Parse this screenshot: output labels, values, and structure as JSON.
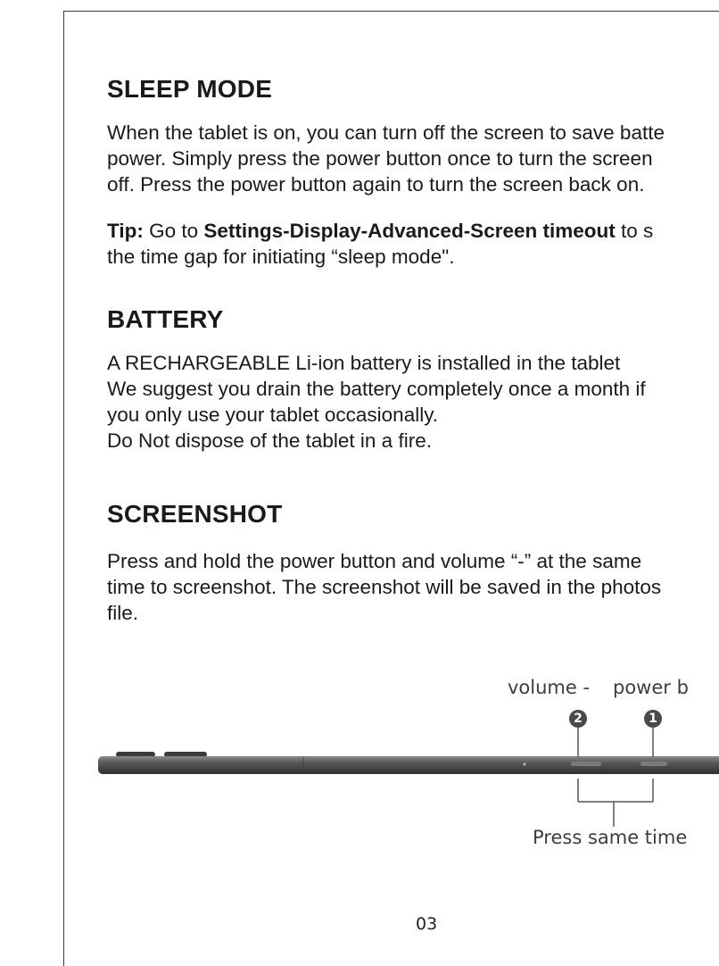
{
  "sleep": {
    "heading": "SLEEP MODE",
    "p1": [
      "When the tablet is on, you can turn off the screen to save batte",
      "power. Simply press the power button once to turn the screen",
      "off. Press the power button again to turn the screen back on."
    ],
    "tip_label": "Tip:",
    "tip_text_1": " Go to ",
    "tip_path": "Settings-Display-Advanced-Screen timeout",
    "tip_text_2": " to s",
    "tip_line2": "the time gap for initiating “sleep mode\"."
  },
  "battery": {
    "heading": "BATTERY",
    "lines": [
      "A RECHARGEABLE Li-ion battery is installed in the tablet",
      "We suggest you drain the battery completely once a month if",
      "you only use your tablet occasionally.",
      "Do Not dispose of the tablet in a fire."
    ]
  },
  "screenshot": {
    "heading": "SCREENSHOT",
    "lines": [
      "Press and hold the power button and volume “-” at the same",
      "time to screenshot. The screenshot will be saved in the photos",
      "file."
    ]
  },
  "diagram": {
    "volume_label": "volume -",
    "power_label": "power b",
    "volume_number": "2",
    "power_number": "1",
    "caption": "Press same time"
  },
  "page_number": "03"
}
